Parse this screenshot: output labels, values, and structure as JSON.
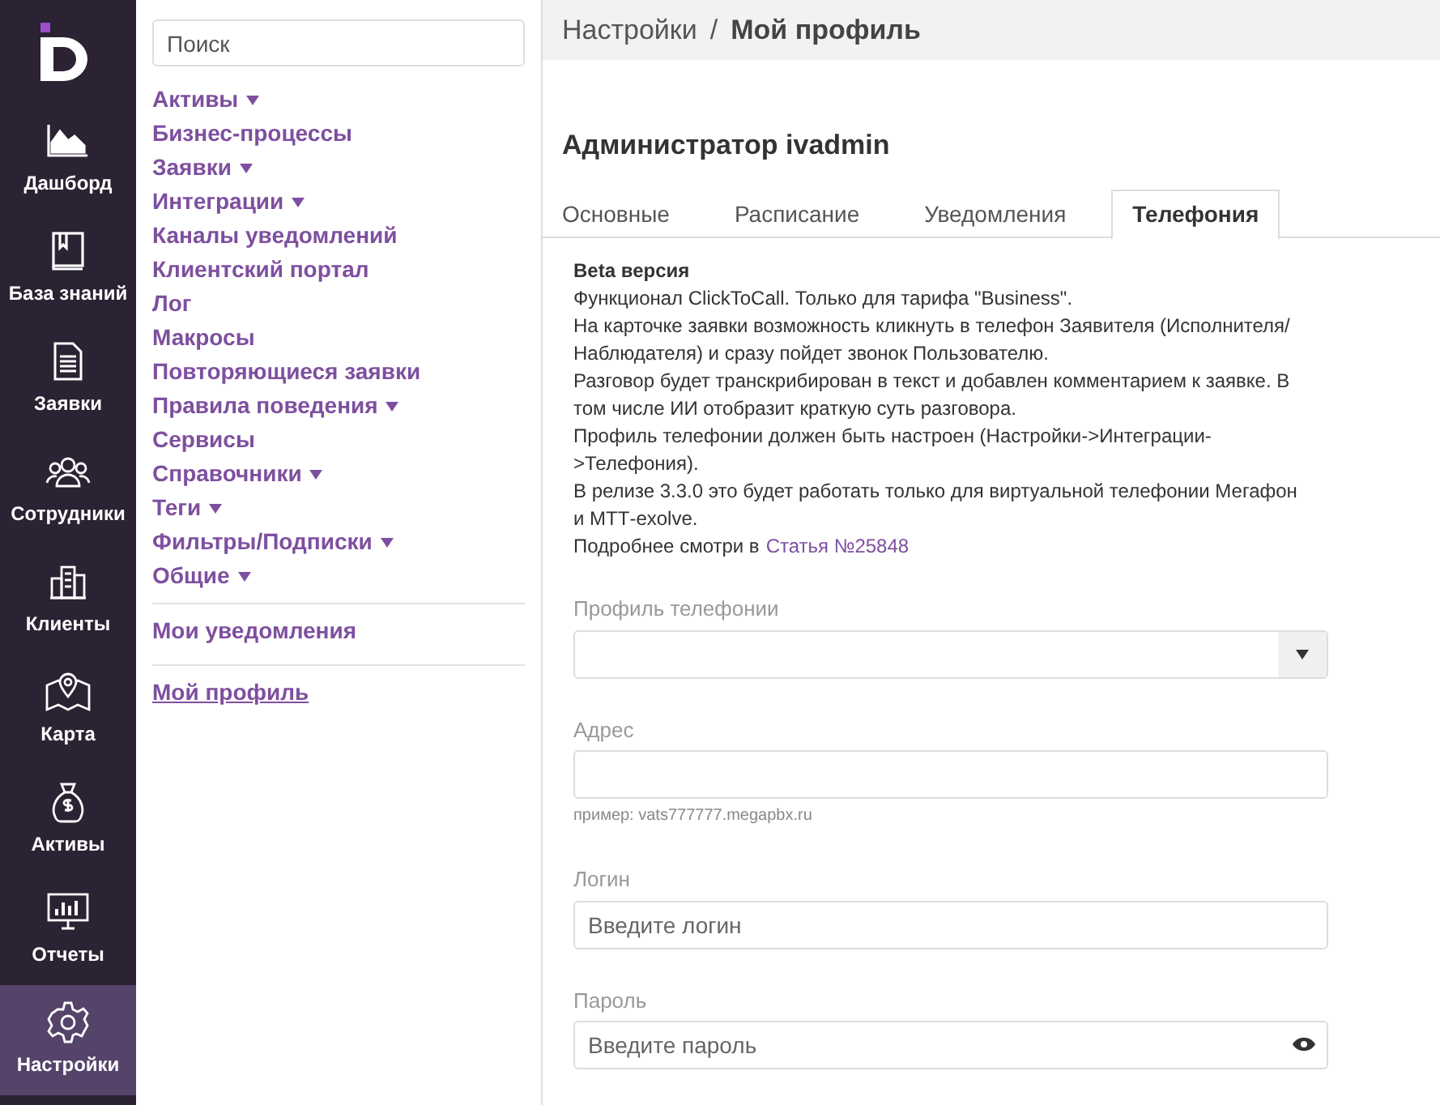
{
  "nav": [
    {
      "label": "Дашборд",
      "selected": false
    },
    {
      "label": "База знаний",
      "selected": false
    },
    {
      "label": "Заявки",
      "selected": false
    },
    {
      "label": "Сотрудники",
      "selected": false
    },
    {
      "label": "Клиенты",
      "selected": false
    },
    {
      "label": "Карта",
      "selected": false
    },
    {
      "label": "Активы",
      "selected": false
    },
    {
      "label": "Отчеты",
      "selected": false
    },
    {
      "label": "Настройки",
      "selected": true
    }
  ],
  "settings_menu": {
    "search": {
      "placeholder": "Поиск"
    },
    "groups": [
      [
        {
          "label": "Активы",
          "expandable": true,
          "selected": false
        },
        {
          "label": "Бизнес-процессы",
          "expandable": false,
          "selected": false
        },
        {
          "label": "Заявки",
          "expandable": true,
          "selected": false
        },
        {
          "label": "Интеграции",
          "expandable": true,
          "selected": false
        },
        {
          "label": "Каналы уведомлений",
          "expandable": false,
          "selected": false
        },
        {
          "label": "Клиентский портал",
          "expandable": false,
          "selected": false
        },
        {
          "label": "Лог",
          "expandable": false,
          "selected": false
        },
        {
          "label": "Макросы",
          "expandable": false,
          "selected": false
        },
        {
          "label": "Повторяющиеся заявки",
          "expandable": false,
          "selected": false
        },
        {
          "label": "Правила поведения",
          "expandable": true,
          "selected": false
        },
        {
          "label": "Сервисы",
          "expandable": false,
          "selected": false
        },
        {
          "label": "Справочники",
          "expandable": true,
          "selected": false
        },
        {
          "label": "Теги",
          "expandable": true,
          "selected": false
        },
        {
          "label": "Фильтры/Подписки",
          "expandable": true,
          "selected": false
        },
        {
          "label": "Общие",
          "expandable": true,
          "selected": false
        }
      ],
      [
        {
          "label": "Мои уведомления",
          "expandable": false,
          "selected": false
        }
      ],
      [
        {
          "label": "Мой профиль",
          "expandable": false,
          "selected": true
        }
      ]
    ]
  },
  "breadcrumb": {
    "parent": "Настройки",
    "separator": "/",
    "current": "Мой профиль"
  },
  "profile_title": "Администратор ivadmin",
  "tabs": [
    {
      "label": "Основные",
      "selected": false
    },
    {
      "label": "Расписание",
      "selected": false
    },
    {
      "label": "Уведомления",
      "selected": false
    },
    {
      "label": "Телефония",
      "selected": true
    }
  ],
  "notice": {
    "heading": "Beta версия",
    "lines": [
      "Функционал ClickToCall. Только для тарифа \"Business\".",
      "На карточке заявки возможность кликнуть в телефон Заявителя (Исполнителя/Наблюдателя) и сразу пойдет звонок Пользователю.",
      "Разговор будет транскрибирован в текст и добавлен комментарием к заявке. В том числе ИИ отобразит краткую суть разговора.",
      "Профиль телефонии должен быть настроен (Настройки->Интеграции->Телефония).",
      "В релизе 3.3.0 это будет работать только для виртуальной телефонии Мегафон и МТТ-exolve."
    ],
    "more_text": "Подробнее смотри в",
    "link": "Статья №25848"
  },
  "fields": [
    {
      "kind": "select",
      "label": "Профиль телефонии"
    },
    {
      "kind": "text",
      "label": "Адрес",
      "hint": "пример: vats777777.megapbx.ru"
    },
    {
      "kind": "text",
      "label": "Логин",
      "placeholder": "Введите логин"
    },
    {
      "kind": "password",
      "label": "Пароль",
      "placeholder": "Введите пароль"
    }
  ]
}
